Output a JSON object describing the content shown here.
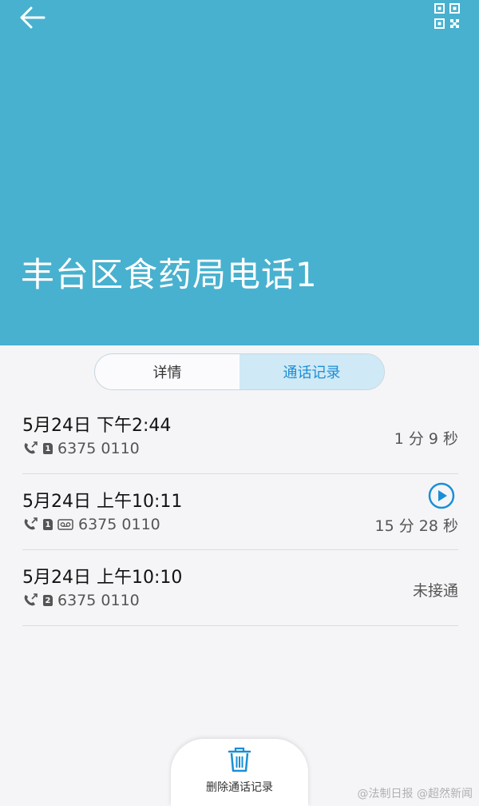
{
  "header": {
    "contact_name": "丰台区食药局电话1",
    "background_color": "#48b1cf"
  },
  "tabs": [
    {
      "label": "详情",
      "active": false
    },
    {
      "label": "通话记录",
      "active": true
    }
  ],
  "calls": [
    {
      "time": "5月24日 下午2:44",
      "sim": "1",
      "number": "6375 0110",
      "duration": "1 分 9 秒",
      "recording": false
    },
    {
      "time": "5月24日 上午10:11",
      "sim": "1",
      "number": "6375 0110",
      "duration": "15 分 28 秒",
      "recording": true
    },
    {
      "time": "5月24日 上午10:10",
      "sim": "2",
      "number": "6375 0110",
      "duration": "未接通",
      "recording": false
    }
  ],
  "footer": {
    "delete_label": "删除通话记录"
  },
  "watermark": "@法制日报  @超然新闻",
  "colors": {
    "accent": "#1a8fd6",
    "active_tab_bg": "#cfe9f6"
  }
}
